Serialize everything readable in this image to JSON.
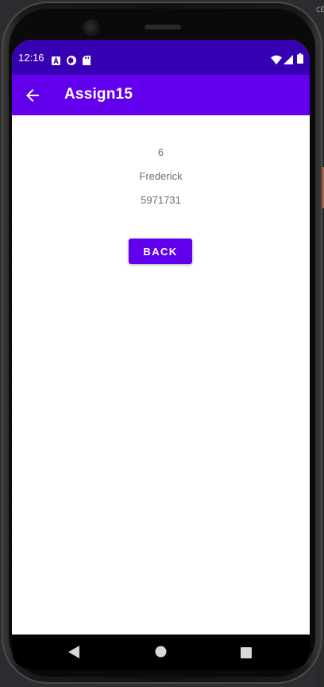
{
  "status_bar": {
    "time": "12:16",
    "icons": [
      "a-icon",
      "sync-icon",
      "sd-card-icon",
      "wifi-icon",
      "signal-icon",
      "battery-icon"
    ]
  },
  "app_bar": {
    "title": "Assign15",
    "nav_icon": "arrow-back-icon"
  },
  "content": {
    "id_text": "6",
    "name_text": "Frederick",
    "number_text": "5971731",
    "back_button_label": "BACK"
  },
  "nav_bar": {
    "buttons": [
      "back-triangle-icon",
      "home-circle-icon",
      "recents-square-icon"
    ]
  },
  "colors": {
    "status_bar": "#3700b3",
    "app_bar": "#6200ee",
    "button": "#6200ee",
    "text": "#6e6e6e",
    "background": "#ffffff"
  },
  "background_ide": {
    "visible_text": "CE"
  }
}
